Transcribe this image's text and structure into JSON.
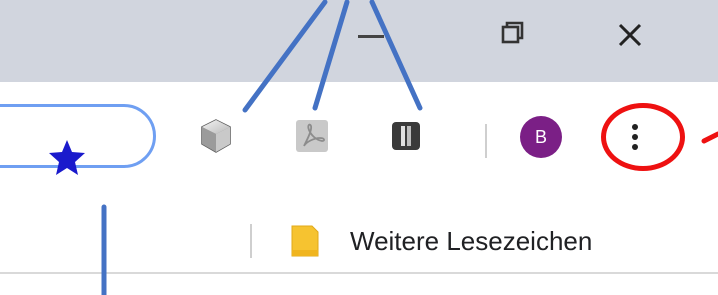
{
  "window": {
    "minimize_label": "Minimize",
    "maximize_label": "Restore",
    "close_label": "Close"
  },
  "omnibox": {
    "star_icon": "star-icon",
    "star_color": "#1a1acc"
  },
  "extensions": [
    {
      "icon": "cube-extension-icon"
    },
    {
      "icon": "pdf-extension-icon"
    },
    {
      "icon": "gate-extension-icon"
    }
  ],
  "profile": {
    "initial": "B",
    "color": "#7b1f86"
  },
  "menu": {
    "icon": "more-vert-icon",
    "highlight_color": "#ee1111"
  },
  "bookmarks": {
    "other_bookmarks_label": "Weitere Lesezeichen",
    "folder_color": "#f6c330"
  },
  "annotation_color": "#4472c4"
}
